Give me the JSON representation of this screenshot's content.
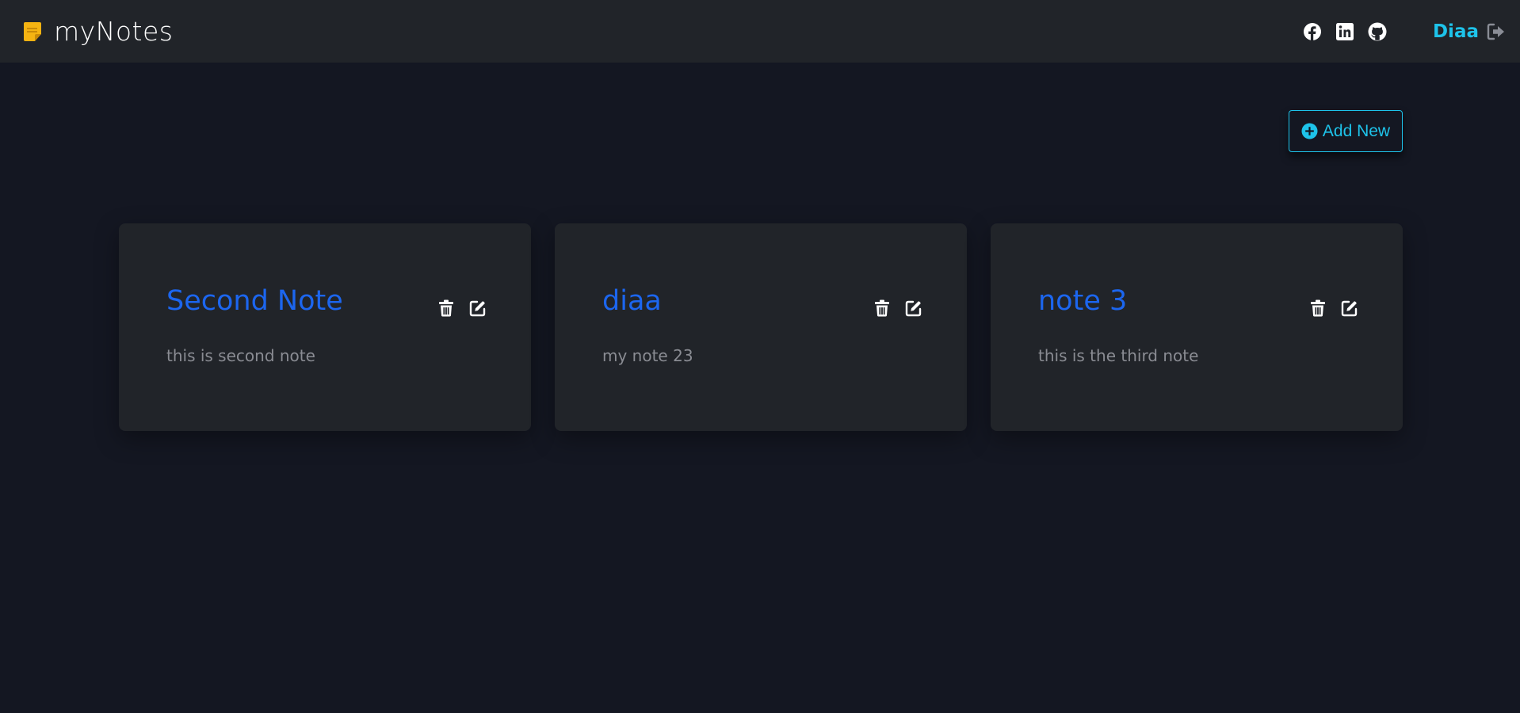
{
  "brand": {
    "name": "myNotes",
    "icon": "sticky-note-icon",
    "icon_color": "#f5b312"
  },
  "socials": [
    {
      "name": "facebook",
      "icon": "facebook-icon"
    },
    {
      "name": "linkedin",
      "icon": "linkedin-icon"
    },
    {
      "name": "github",
      "icon": "github-icon"
    }
  ],
  "user": {
    "name": "Diaa",
    "logout_icon": "sign-out-icon"
  },
  "add_button": {
    "label": "Add New",
    "icon": "plus-circle-icon"
  },
  "notes": [
    {
      "title": "Second Note",
      "body": "this is second note"
    },
    {
      "title": "diaa",
      "body": "my note 23"
    },
    {
      "title": "note 3",
      "body": "this is the third note"
    }
  ],
  "colors": {
    "background": "#141722",
    "surface": "#212429",
    "accent": "#1ec3ea",
    "title": "#1c66ef",
    "muted_text": "#8a8c93"
  }
}
